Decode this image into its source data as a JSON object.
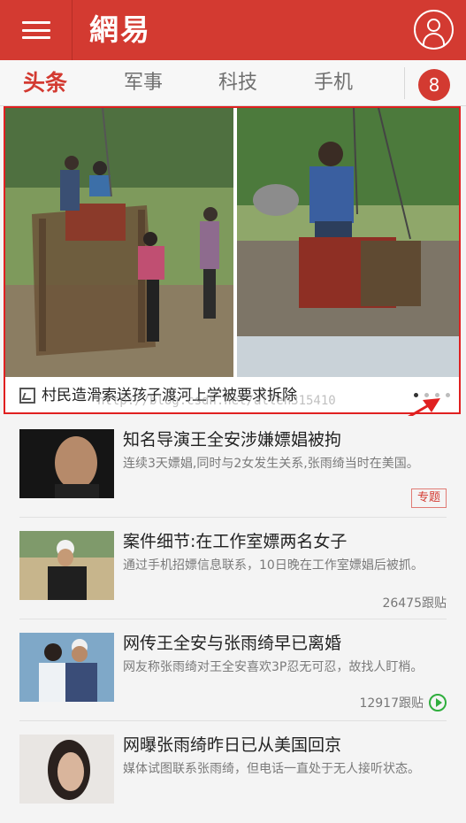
{
  "appbar": {
    "logo": "網易",
    "icons": {
      "menu": "menu-icon",
      "user": "user-icon"
    }
  },
  "tabs": {
    "items": [
      "头条",
      "军事",
      "科技",
      "手机"
    ],
    "active": 0,
    "badge": "8"
  },
  "banner": {
    "caption": "村民造滑索送孩子渡河上学被要求拆除",
    "page_count": 4,
    "active_page": 0,
    "highlight_color": "#e02020"
  },
  "watermark": "http://blog.csdn.net/allen315410",
  "feed": [
    {
      "title": "知名导演王全安涉嫌嫖娼被拘",
      "desc": "连续3天嫖娼,同时与2女发生关系,张雨绮当时在美国。",
      "tag": "专题",
      "meta": ""
    },
    {
      "title": "案件细节:在工作室嫖两名女子",
      "desc": "通过手机招嫖信息联系，10日晚在工作室嫖娼后被抓。",
      "tag": "",
      "meta": "26475跟贴"
    },
    {
      "title": "网传王全安与张雨绮早已离婚",
      "desc": "网友称张雨绮对王全安喜欢3P忍无可忍，故找人盯梢。",
      "tag": "",
      "meta": "12917跟贴"
    },
    {
      "title": "网曝张雨绮昨日已从美国回京",
      "desc": "媒体试图联系张雨绮，但电话一直处于无人接听状态。",
      "tag": "",
      "meta": ""
    }
  ],
  "colors": {
    "brand": "#d33a31",
    "annotation": "#e02020"
  }
}
